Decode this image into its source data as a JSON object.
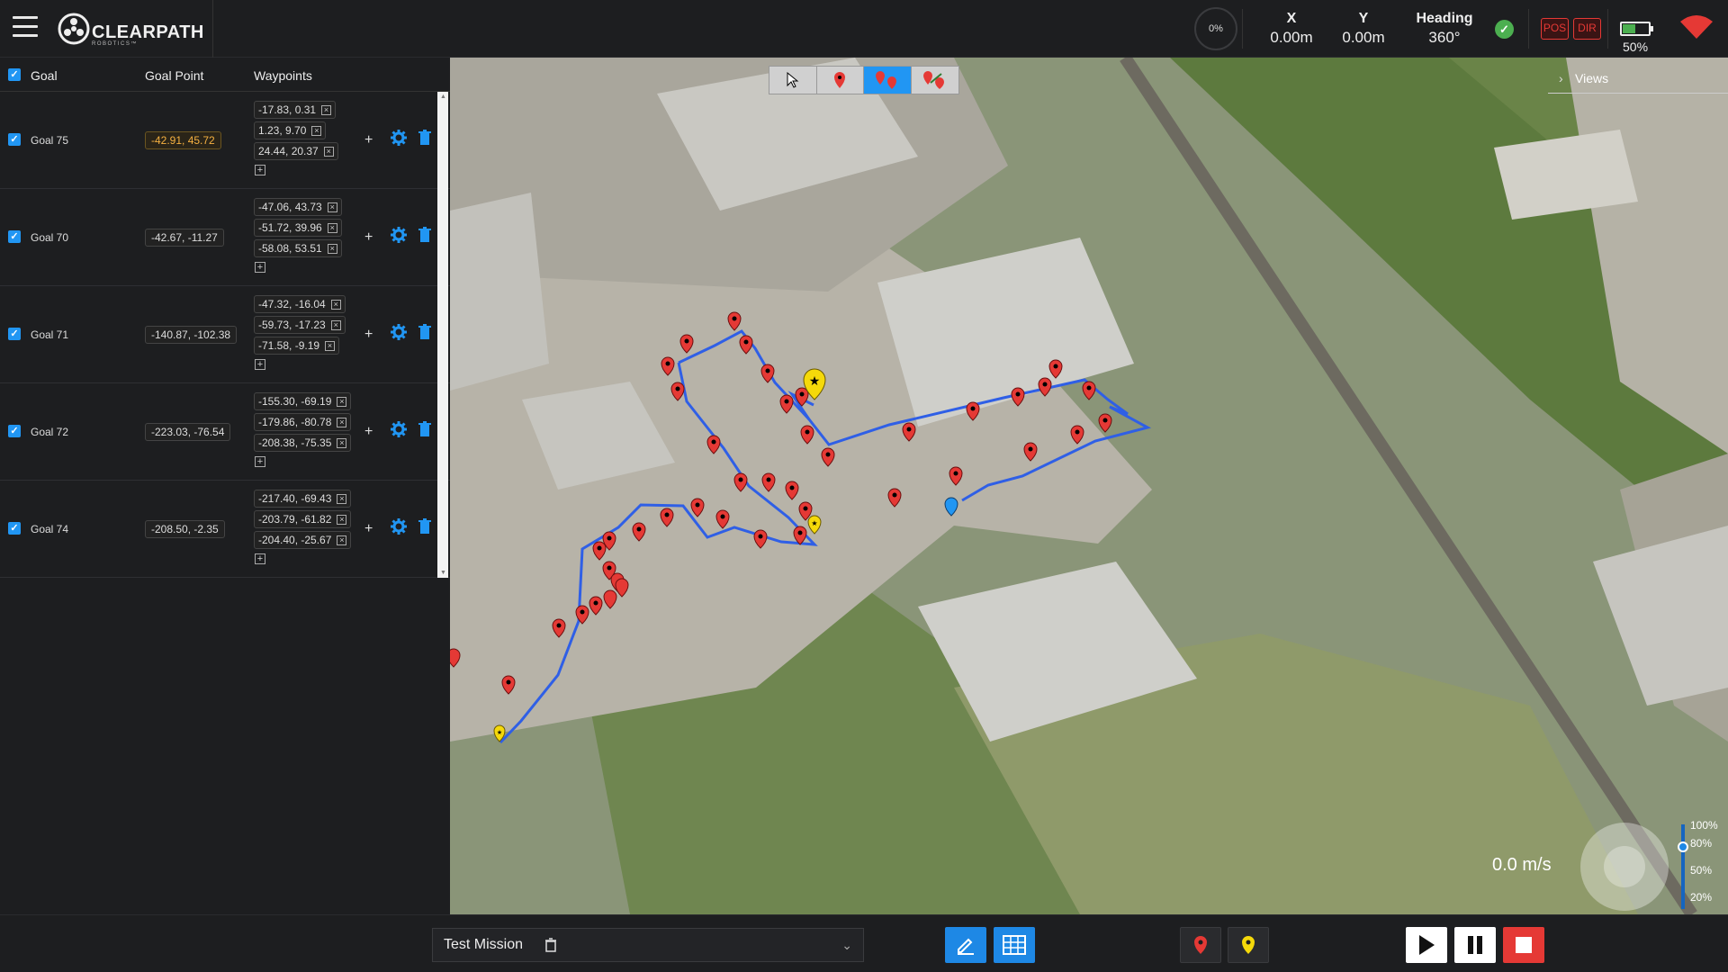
{
  "app": {
    "brand": "CLEARPATH",
    "brand_sub": "ROBOTICS™",
    "menu_icon": "hamburger-menu-icon"
  },
  "status": {
    "progress": "0%",
    "x_label": "X",
    "x_value": "0.00m",
    "y_label": "Y",
    "y_value": "0.00m",
    "heading_label": "Heading",
    "heading_value": "360°",
    "pos_label": "POS",
    "dir_label": "DIR",
    "battery": "50%",
    "battery_level": 0.5,
    "colors": {
      "ok": "#4caf50",
      "alert": "#e53935",
      "wifi": "#e53935",
      "accent": "#2196f3"
    }
  },
  "goals_table": {
    "headers": {
      "goal": "Goal",
      "goal_point": "Goal Point",
      "waypoints": "Waypoints"
    },
    "rows": [
      {
        "name": "Goal 75",
        "point": "-42.91, 45.72",
        "highlight": true,
        "waypoints": [
          "-17.83, 0.31",
          "1.23, 9.70",
          "24.44, 20.37"
        ]
      },
      {
        "name": "Goal 70",
        "point": "-42.67, -11.27",
        "highlight": false,
        "waypoints": [
          "-47.06, 43.73",
          "-51.72, 39.96",
          "-58.08, 53.51"
        ]
      },
      {
        "name": "Goal 71",
        "point": "-140.87, -102.38",
        "highlight": false,
        "waypoints": [
          "-47.32, -16.04",
          "-59.73, -17.23",
          "-71.58, -9.19"
        ]
      },
      {
        "name": "Goal 72",
        "point": "-223.03, -76.54",
        "highlight": false,
        "waypoints": [
          "-155.30, -69.19",
          "-179.86, -80.78",
          "-208.38, -75.35"
        ]
      },
      {
        "name": "Goal 74",
        "point": "-208.50, -2.35",
        "highlight": false,
        "waypoints": [
          "-217.40, -69.43",
          "-203.79, -61.82",
          "-204.40, -25.67"
        ]
      }
    ]
  },
  "map": {
    "views_label": "Views",
    "speed": "0.0 m/s",
    "speed_levels": [
      "100%",
      "80%",
      "50%",
      "20%"
    ],
    "speed_level": 0.8,
    "toolbar_icons": [
      "cursor-icon",
      "waypoint-icon",
      "multi-waypoint-icon",
      "route-edit-icon"
    ]
  },
  "bottom": {
    "mission_name": "Test Mission"
  }
}
